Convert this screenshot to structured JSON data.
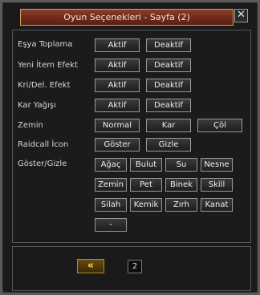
{
  "window": {
    "title": "Oyun Seçenekleri - Sayfa (2)",
    "close_symbol": "✕"
  },
  "rows": [
    {
      "label": "Eşya Toplama",
      "buttons": [
        "Aktif",
        "Deaktif"
      ]
    },
    {
      "label": "Yeni İtem Efekt",
      "buttons": [
        "Aktif",
        "Deaktif"
      ]
    },
    {
      "label": "Kri/Del. Efekt",
      "buttons": [
        "Aktif",
        "Deaktif"
      ]
    },
    {
      "label": "Kar Yağışı",
      "buttons": [
        "Aktif",
        "Deaktif"
      ]
    },
    {
      "label": "Zemin",
      "buttons": [
        "Normal",
        "Kar",
        "Çöl"
      ]
    },
    {
      "label": "Raidcall İcon",
      "buttons": [
        "Göster",
        "Gizle"
      ]
    },
    {
      "label": "Göster/Gizle",
      "buttons": []
    }
  ],
  "filters": [
    "Ağaç",
    "Bulut",
    "Su",
    "Nesne",
    "Zemin",
    "Pet",
    "Binek",
    "Skill",
    "Silah",
    "Kemik",
    "Zırh",
    "Kanat",
    "-"
  ],
  "footer": {
    "back_symbol": "«",
    "page_number": "2"
  }
}
